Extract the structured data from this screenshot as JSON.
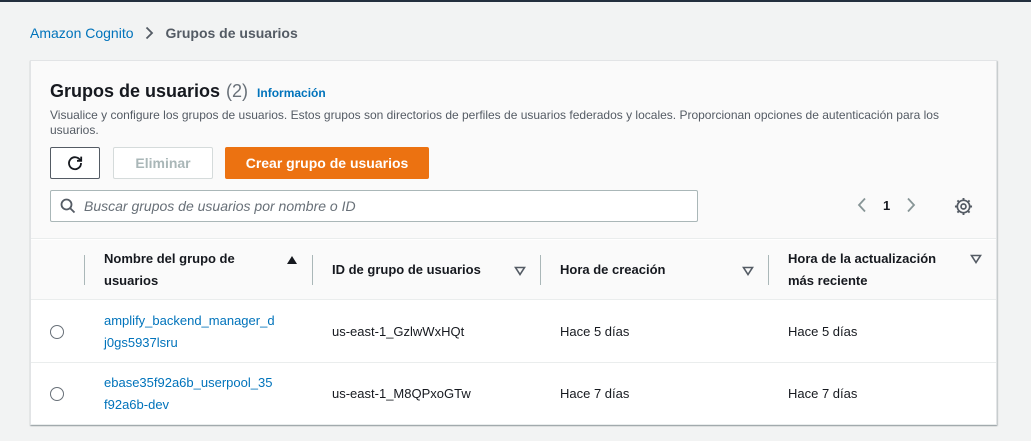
{
  "breadcrumb": {
    "root": "Amazon Cognito",
    "current": "Grupos de usuarios"
  },
  "panel": {
    "title": "Grupos de usuarios",
    "count": "(2)",
    "info_link": "Información",
    "description": "Visualice y configure los grupos de usuarios. Estos grupos son directorios de perfiles de usuarios federados y locales. Proporcionan opciones de autenticación para los usuarios."
  },
  "actions": {
    "refresh_icon": "refresh-icon",
    "delete_label": "Eliminar",
    "create_label": "Crear grupo de usuarios"
  },
  "search": {
    "placeholder": "Buscar grupos de usuarios por nombre o ID",
    "value": ""
  },
  "pagination": {
    "current_page": "1"
  },
  "table": {
    "columns": [
      {
        "label_line1": "Nombre del grupo de",
        "label_line2": "usuarios",
        "sort": "ascending"
      },
      {
        "label": "ID de grupo de usuarios"
      },
      {
        "label": "Hora de creación"
      },
      {
        "label_line1": "Hora de la actualización",
        "label_line2": "más reciente"
      }
    ],
    "rows": [
      {
        "name_line1": "amplify_backend_manager_d",
        "name_line2": "j0gs5937lsru",
        "id": "us-east-1_GzlwWxHQt",
        "created": "Hace 5 días",
        "updated": "Hace 5 días",
        "selected": false
      },
      {
        "name_line1": "ebase35f92a6b_userpool_35",
        "name_line2": "f92a6b-dev",
        "id": "us-east-1_M8QPxoGTw",
        "created": "Hace 7 días",
        "updated": "Hace 7 días",
        "selected": false
      }
    ]
  },
  "colors": {
    "link": "#0073bb",
    "primary_button": "#ec7211",
    "page_bg": "#f2f3f3"
  }
}
